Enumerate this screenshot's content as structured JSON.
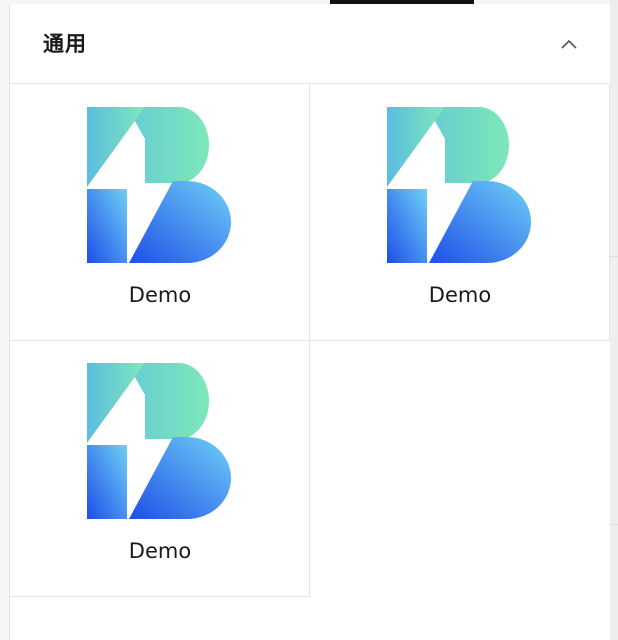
{
  "section": {
    "title": "通用",
    "collapse_icon": "chevron-up-icon"
  },
  "apps": [
    {
      "label": "Demo",
      "icon": "demo-app-logo-icon"
    },
    {
      "label": "Demo",
      "icon": "demo-app-logo-icon"
    },
    {
      "label": "Demo",
      "icon": "demo-app-logo-icon"
    }
  ],
  "colors": {
    "logo_green": "#7ee8b8",
    "logo_cyan": "#5bc3e8",
    "logo_blue": "#1e4ee8",
    "logo_light_blue": "#69c8f5",
    "border": "#e3e3e3",
    "text": "#1a1a1a"
  }
}
